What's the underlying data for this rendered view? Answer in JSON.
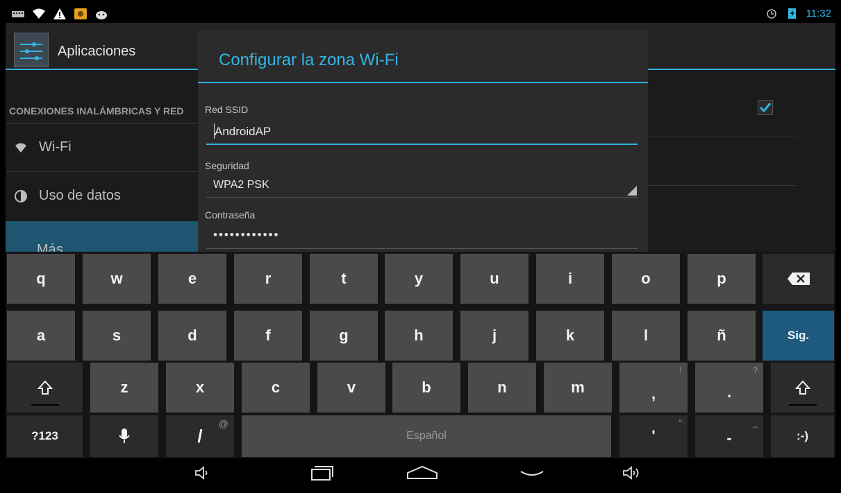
{
  "status_bar": {
    "icons_left": [
      "keyboard-icon",
      "wifi-icon",
      "warning-icon",
      "app-notification-icon",
      "android-icon"
    ],
    "icons_right": [
      "alarm-icon",
      "battery-charging-icon"
    ],
    "time": "11:32"
  },
  "settings": {
    "title": "Aplicaciones",
    "section_header": "CONEXIONES INALÁMBRICAS Y RED",
    "items": [
      {
        "label": "Wi-Fi",
        "icon": "wifi-icon"
      },
      {
        "label": "Uso de datos",
        "icon": "data-usage-icon"
      },
      {
        "label": "Más...",
        "icon": ""
      }
    ],
    "checkbox_checked": true
  },
  "dialog": {
    "title": "Configurar la zona Wi-Fi",
    "ssid_label": "Red SSID",
    "ssid_value": "AndroidAP",
    "security_label": "Seguridad",
    "security_value": "WPA2 PSK",
    "password_label": "Contraseña",
    "password_value": "••••••••••••"
  },
  "keyboard": {
    "row1": [
      "q",
      "w",
      "e",
      "r",
      "t",
      "y",
      "u",
      "i",
      "o",
      "p"
    ],
    "row2": [
      "a",
      "s",
      "d",
      "f",
      "g",
      "h",
      "j",
      "k",
      "l",
      "ñ"
    ],
    "row3": [
      "z",
      "x",
      "c",
      "v",
      "b",
      "n",
      "m",
      ",",
      "."
    ],
    "row3_hints": {
      ",": "!",
      ".": "?"
    },
    "enter_label": "Sig.",
    "symbols_label": "?123",
    "slash_label": "/",
    "slash_hint": "@",
    "space_label": "Español",
    "apostrophe_label": "'",
    "apostrophe_hint": "\"",
    "dash_label": "-",
    "dash_hint": "_",
    "smiley_label": ":-)"
  },
  "nav_bar": {
    "buttons": [
      "volume-down-icon",
      "recent-apps-icon",
      "home-icon",
      "hide-keyboard-icon",
      "volume-up-icon"
    ]
  },
  "colors": {
    "accent": "#33b5e5",
    "selected": "#1e5570",
    "key": "#4a4a4a",
    "enter_key": "#1e5a7e"
  }
}
